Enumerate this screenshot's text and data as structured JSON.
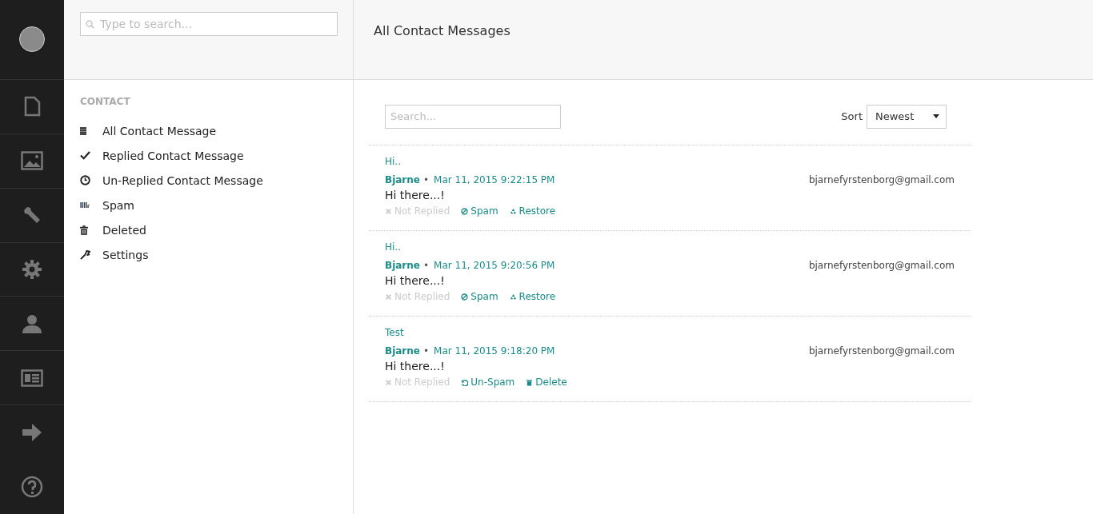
{
  "sidebar": {
    "search": {
      "placeholder": "Type to search..."
    },
    "section_title": "CONTACT",
    "items": [
      {
        "kind": "list",
        "label": "All Contact Message"
      },
      {
        "kind": "check",
        "label": "Replied Contact Message"
      },
      {
        "kind": "clock",
        "label": "Un-Replied Contact Message"
      },
      {
        "kind": "spam",
        "label": "Spam"
      },
      {
        "kind": "trash",
        "label": "Deleted"
      },
      {
        "kind": "wrench",
        "label": "Settings"
      }
    ]
  },
  "main": {
    "title": "All Contact Messages",
    "search": {
      "placeholder": "Search..."
    },
    "sort": {
      "label": "Sort",
      "value": "Newest"
    },
    "messages": [
      {
        "subject": "Hi..",
        "author": "Bjarne",
        "separator": "•",
        "date": "Mar 11, 2015 9:22:15 PM",
        "body": "Hi there...!",
        "email": "bjarnefyrstenborg@gmail.com",
        "actions": [
          {
            "kind": "status",
            "label": "Not Replied",
            "disabled": true
          },
          {
            "kind": "spam",
            "label": "Spam",
            "disabled": false
          },
          {
            "kind": "restore",
            "label": "Restore",
            "disabled": false
          }
        ]
      },
      {
        "subject": "Hi..",
        "author": "Bjarne",
        "separator": "•",
        "date": "Mar 11, 2015 9:20:56 PM",
        "body": "Hi there...!",
        "email": "bjarnefyrstenborg@gmail.com",
        "actions": [
          {
            "kind": "status",
            "label": "Not Replied",
            "disabled": true
          },
          {
            "kind": "spam",
            "label": "Spam",
            "disabled": false
          },
          {
            "kind": "restore",
            "label": "Restore",
            "disabled": false
          }
        ]
      },
      {
        "subject": "Test",
        "author": "Bjarne",
        "separator": "•",
        "date": "Mar 11, 2015 9:18:20 PM",
        "body": "Hi there...!",
        "email": "bjarnefyrstenborg@gmail.com",
        "actions": [
          {
            "kind": "status",
            "label": "Not Replied",
            "disabled": true
          },
          {
            "kind": "unspam",
            "label": "Un-Spam",
            "disabled": false
          },
          {
            "kind": "delete",
            "label": "Delete",
            "disabled": false
          }
        ]
      }
    ]
  }
}
